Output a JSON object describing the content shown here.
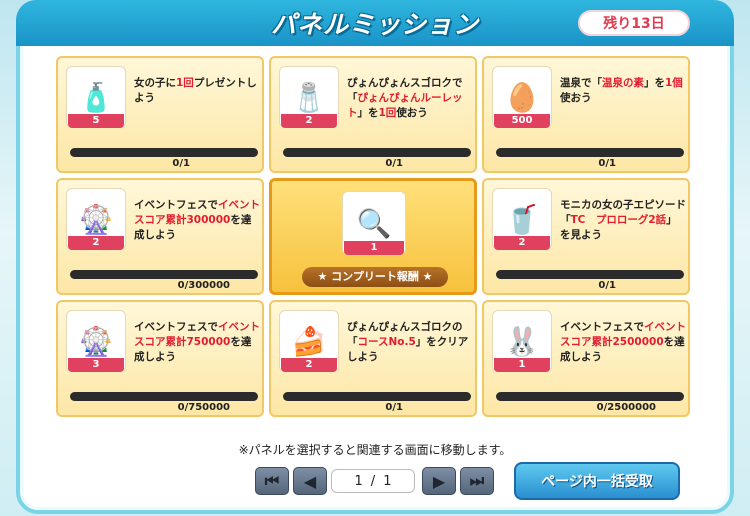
{
  "header": {
    "title": "パネルミッション",
    "remaining": "残り13日"
  },
  "panels": [
    {
      "qty": "5",
      "desc_parts": [
        "女の子に",
        "1回",
        "プレゼントしよう"
      ],
      "progress": "0/1",
      "icon": "gift-bottle-icon"
    },
    {
      "qty": "2",
      "desc_parts": [
        "ぴょんぴょんスゴロクで「",
        "ぴょんぴょんルーレット",
        "」を",
        "1回",
        "使おう"
      ],
      "progress": "0/1",
      "icon": "bath-salts-icon"
    },
    {
      "qty": "500",
      "desc_parts": [
        "温泉で「",
        "温泉の素",
        "」を",
        "1個",
        "使おう"
      ],
      "progress": "0/1",
      "icon": "onsen-medal-icon"
    },
    {
      "qty": "2",
      "desc_parts": [
        "イベントフェスで",
        "イベントスコア累計300000",
        "を達成しよう"
      ],
      "progress": "0/300000",
      "icon": "roulette-icon"
    },
    {
      "qty": "1",
      "complete_label": "コンプリート報酬",
      "icon": "magnifier-icon"
    },
    {
      "qty": "2",
      "desc_parts": [
        "モニカの女の子エピソード「",
        "TC　プロローグ2話",
        "」を見よう"
      ],
      "progress": "0/1",
      "icon": "frappe-icon"
    },
    {
      "qty": "3",
      "desc_parts": [
        "イベントフェスで",
        "イベントスコア累計750000",
        "を達成しよう"
      ],
      "progress": "0/750000",
      "icon": "roulette-icon"
    },
    {
      "qty": "2",
      "desc_parts": [
        "ぴょんぴょんスゴロクの「",
        "コースNo.5",
        "」をクリアしよう"
      ],
      "progress": "0/1",
      "icon": "cake-icon"
    },
    {
      "qty": "1",
      "desc_parts": [
        "イベントフェスで",
        "イベントスコア累計2500000",
        "を達成しよう"
      ],
      "progress": "0/2500000",
      "icon": "bunny-ears-icon"
    }
  ],
  "footer": {
    "notice": "※パネルを選択すると関連する画面に移動します。",
    "page_current": "1",
    "page_sep": "/",
    "page_total": "1",
    "collect_label": "ページ内一括受取"
  },
  "colors": {
    "accent": "#1a93c7",
    "highlight": "#e11d2f"
  }
}
